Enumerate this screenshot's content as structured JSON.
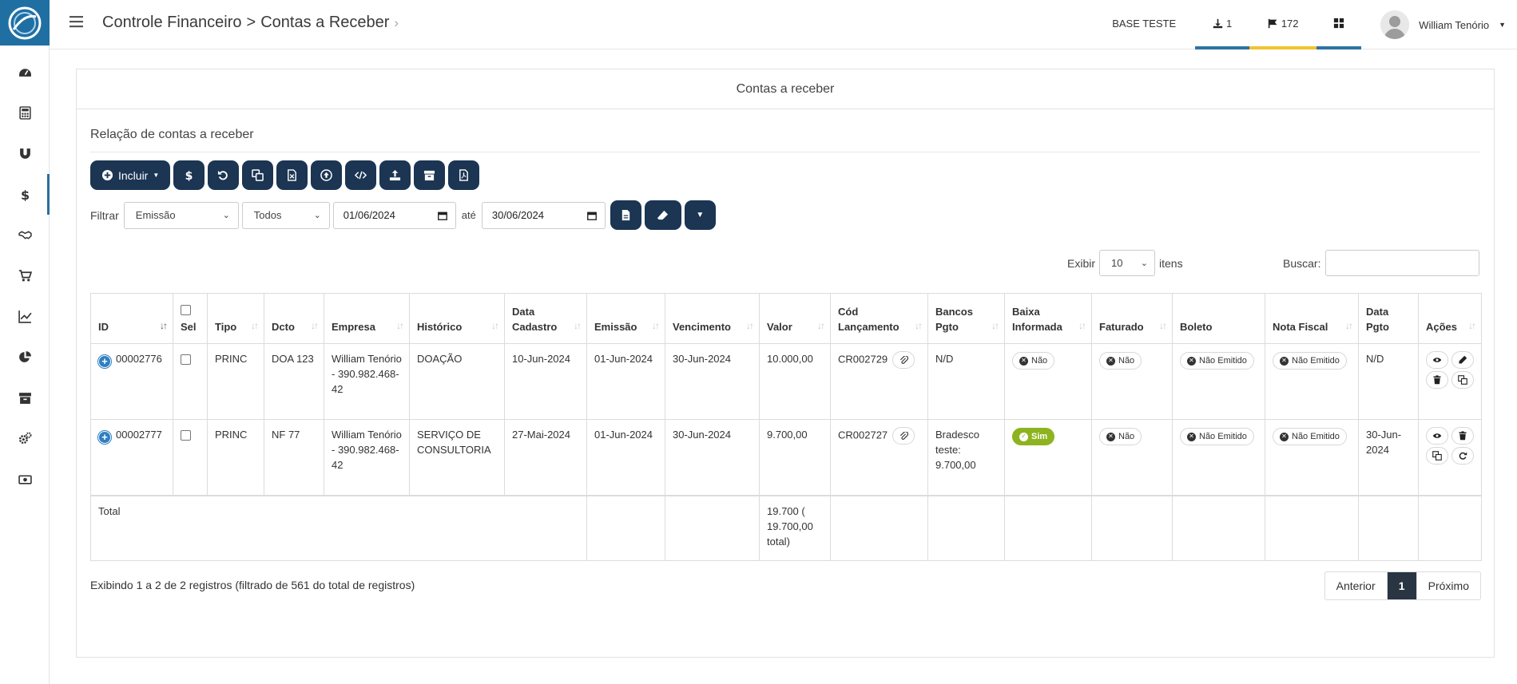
{
  "header": {
    "breadcrumb_root": "Controle Financeiro",
    "breadcrumb_sep": ">",
    "breadcrumb_current": "Contas a Receber",
    "base": "BASE TESTE",
    "downloads_count": "1",
    "flags_count": "172",
    "user_name": "William Tenório"
  },
  "panel": {
    "title": "Contas a receber",
    "section_title": "Relação de contas a receber"
  },
  "toolbar": {
    "incluir_label": "Incluir"
  },
  "filter": {
    "label": "Filtrar",
    "field": "Emissão",
    "status": "Todos",
    "date_from": "01/06/2024",
    "between": "até",
    "date_to": "30/06/2024"
  },
  "list_controls": {
    "show_label": "Exibir",
    "page_size": "10",
    "items_label": "itens",
    "search_label": "Buscar:"
  },
  "table": {
    "columns": [
      "ID",
      "Sel",
      "Tipo",
      "Dcto",
      "Empresa",
      "Histórico",
      "Data Cadastro",
      "Emissão",
      "Vencimento",
      "Valor",
      "Cód Lançamento",
      "Bancos Pgto",
      "Baixa Informada",
      "Faturado",
      "Boleto",
      "Nota Fiscal",
      "Data Pgto",
      "Ações"
    ],
    "rows": [
      {
        "id": "00002776",
        "tipo": "PRINC",
        "dcto": "DOA 123",
        "empresa": "William Tenório - 390.982.468-42",
        "historico": "DOAÇÃO",
        "data_cadastro": "10-Jun-2024",
        "emissao": "01-Jun-2024",
        "vencimento": "30-Jun-2024",
        "valor": "10.000,00",
        "cod_lancamento": "CR002729",
        "bancos_pgto": "N/D",
        "baixa_informada": "Não",
        "faturado": "Não",
        "boleto": "Não Emitido",
        "nota_fiscal": "Não Emitido",
        "data_pgto": "N/D"
      },
      {
        "id": "00002777",
        "tipo": "PRINC",
        "dcto": "NF 77",
        "empresa": "William Tenório - 390.982.468-42",
        "historico": "SERVIÇO DE CONSULTORIA",
        "data_cadastro": "27-Mai-2024",
        "emissao": "01-Jun-2024",
        "vencimento": "30-Jun-2024",
        "valor": "9.700,00",
        "cod_lancamento": "CR002727",
        "bancos_pgto": "Bradesco teste: 9.700,00",
        "baixa_informada": "Sim",
        "faturado": "Não",
        "boleto": "Não Emitido",
        "nota_fiscal": "Não Emitido",
        "data_pgto": "30-Jun-2024"
      }
    ],
    "total_label": "Total",
    "total_value": "19.700 ( 19.700,00 total)"
  },
  "footer": {
    "info": "Exibindo 1 a 2 de 2 registros (filtrado de 561 do total de registros)",
    "prev": "Anterior",
    "page": "1",
    "next": "Próximo"
  },
  "colors": {
    "logo_bg": "#1f6fa3",
    "button_bg": "#1b3553",
    "accent_blue": "#2e73a3",
    "accent_yellow": "#f2c230",
    "success_green": "#8db31f"
  },
  "icons": {
    "sidebar": [
      "dashboard-icon",
      "calculator-icon",
      "magnet-icon",
      "dollar-icon",
      "handshake-icon",
      "cart-icon",
      "line-chart-icon",
      "pie-chart-icon",
      "archive-icon",
      "cogs-icon",
      "money-icon"
    ]
  }
}
